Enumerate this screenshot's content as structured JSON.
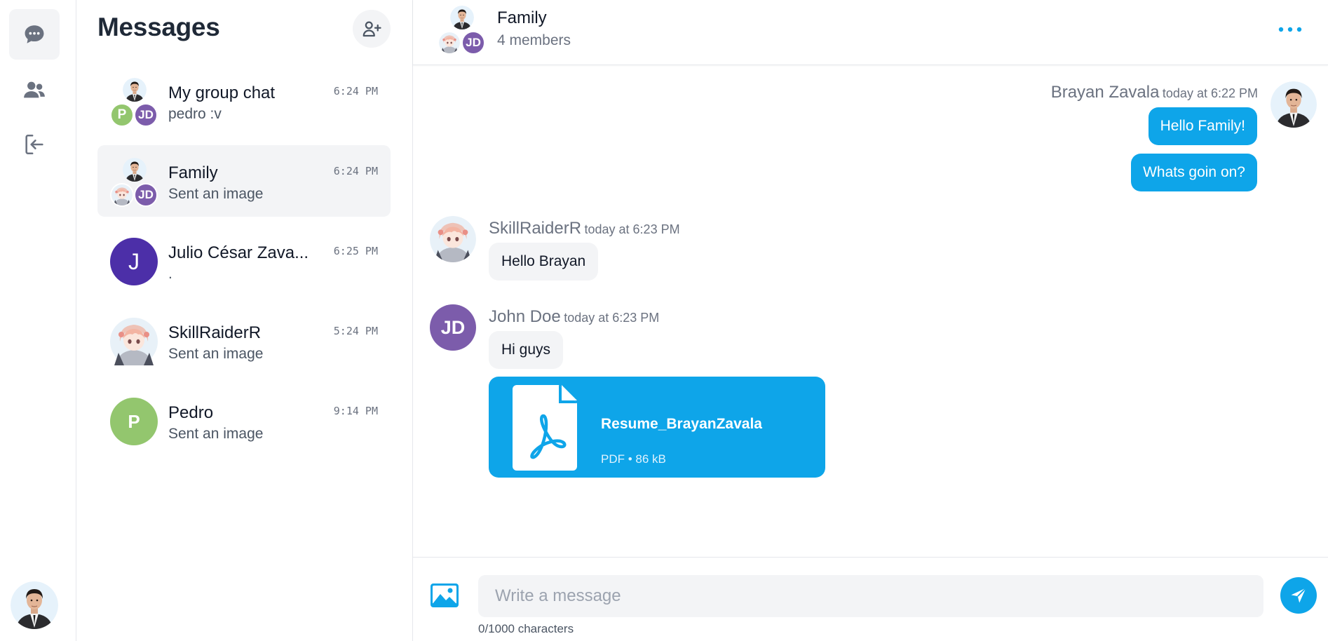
{
  "colors": {
    "accent": "#0ea5e9",
    "muted": "#6b7280",
    "bubble_in": "#f3f4f6",
    "avatar_purple": "#7c5cab",
    "avatar_green": "#93c66e",
    "avatar_indigo": "#4c2fa8"
  },
  "nav": {
    "items": [
      {
        "icon": "chat-bubble-icon",
        "active": true
      },
      {
        "icon": "users-icon",
        "active": false
      },
      {
        "icon": "logout-icon",
        "active": false
      }
    ]
  },
  "sidebar": {
    "title": "Messages",
    "new_chat_icon": "user-plus-icon",
    "conversations": [
      {
        "name": "My group chat",
        "preview": "pedro :v",
        "time": "6:24 PM",
        "avatar_type": "group",
        "initials_a": "P",
        "initials_b": "JD"
      },
      {
        "name": "Family",
        "preview": "Sent an image",
        "time": "6:24 PM",
        "avatar_type": "group",
        "initials_b": "JD",
        "active": true
      },
      {
        "name": "Julio César Zava...",
        "preview": ".",
        "time": "6:25 PM",
        "avatar_type": "initial",
        "initials": "J"
      },
      {
        "name": "SkillRaiderR",
        "preview": "Sent an image",
        "time": "5:24 PM",
        "avatar_type": "anime"
      },
      {
        "name": "Pedro",
        "preview": "Sent an image",
        "time": "9:14 PM",
        "avatar_type": "initial",
        "initials": "P"
      }
    ]
  },
  "chat": {
    "header": {
      "title": "Family",
      "subtitle": "4 members",
      "initials_b": "JD"
    },
    "messages": [
      {
        "sender": "Brayan Zavala",
        "timestamp": "today at 6:22 PM",
        "outgoing": true,
        "texts": [
          "Hello Family!",
          "Whats goin on?"
        ]
      },
      {
        "sender": "SkillRaiderR",
        "timestamp": "today at 6:23 PM",
        "outgoing": false,
        "texts": [
          "Hello Brayan"
        ]
      },
      {
        "sender": "John Doe",
        "initials": "JD",
        "timestamp": "today at 6:23 PM",
        "outgoing": false,
        "texts": [
          "Hi guys"
        ],
        "attachment": {
          "name": "Resume_BrayanZavala",
          "meta": "PDF • 86 kB",
          "icon": "pdf-file-icon"
        }
      }
    ]
  },
  "composer": {
    "placeholder": "Write a message",
    "value": "",
    "char_count": "0/1000 characters",
    "attach_icon": "image-icon",
    "send_icon": "send-icon"
  }
}
